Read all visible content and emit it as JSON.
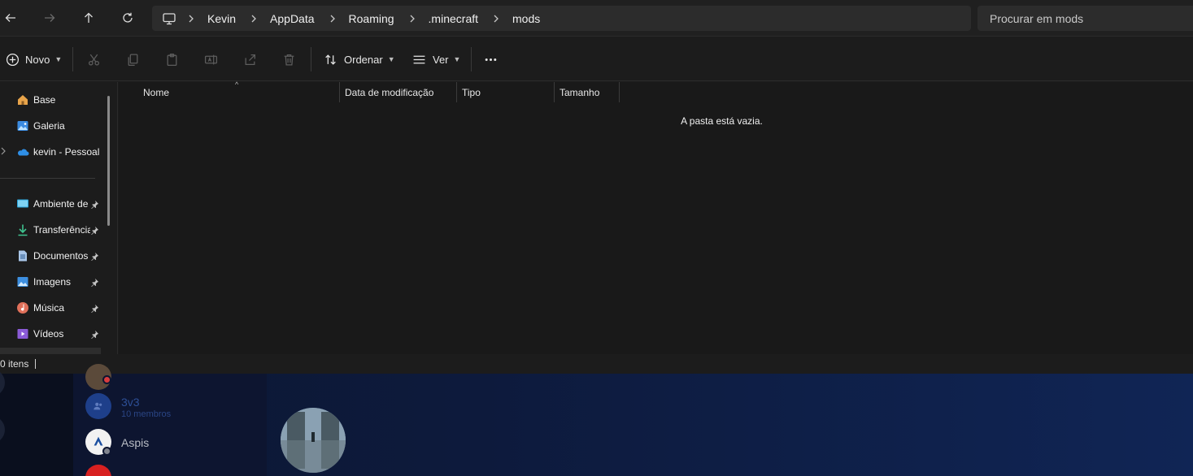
{
  "explorer": {
    "nav": {
      "back": "back-arrow-icon",
      "forward": "forward-arrow-icon",
      "up": "up-arrow-icon",
      "refresh": "refresh-icon"
    },
    "breadcrumbs": [
      "Kevin",
      "AppData",
      "Roaming",
      ".minecraft",
      "mods"
    ],
    "search_placeholder": "Procurar em mods",
    "toolbar": {
      "new_label": "Novo",
      "sort_label": "Ordenar",
      "view_label": "Ver",
      "more": "more-icon"
    },
    "sidebar": {
      "top_items": [
        {
          "label": "Base",
          "icon": "home-icon"
        },
        {
          "label": "Galeria",
          "icon": "gallery-icon"
        },
        {
          "label": "kevin - Pessoal",
          "icon": "onedrive-icon"
        }
      ],
      "pinned_items": [
        {
          "label": "Ambiente de",
          "icon": "desktop-icon"
        },
        {
          "label": "Transferência",
          "icon": "download-icon"
        },
        {
          "label": "Documentos",
          "icon": "documents-icon"
        },
        {
          "label": "Imagens",
          "icon": "pictures-icon"
        },
        {
          "label": "Música",
          "icon": "music-icon"
        },
        {
          "label": "Vídeos",
          "icon": "videos-icon"
        }
      ]
    },
    "columns": [
      "Nome",
      "Data de modificação",
      "Tipo",
      "Tamanho"
    ],
    "empty_message": "A pasta está vazia.",
    "status": "0 itens"
  },
  "discord": {
    "items": [
      {
        "name": "3v3",
        "sub": "10 membros"
      },
      {
        "name": "Aspis"
      }
    ],
    "colors": {
      "accent": "#1e3f8a",
      "status_red": "#d83c3e"
    }
  }
}
